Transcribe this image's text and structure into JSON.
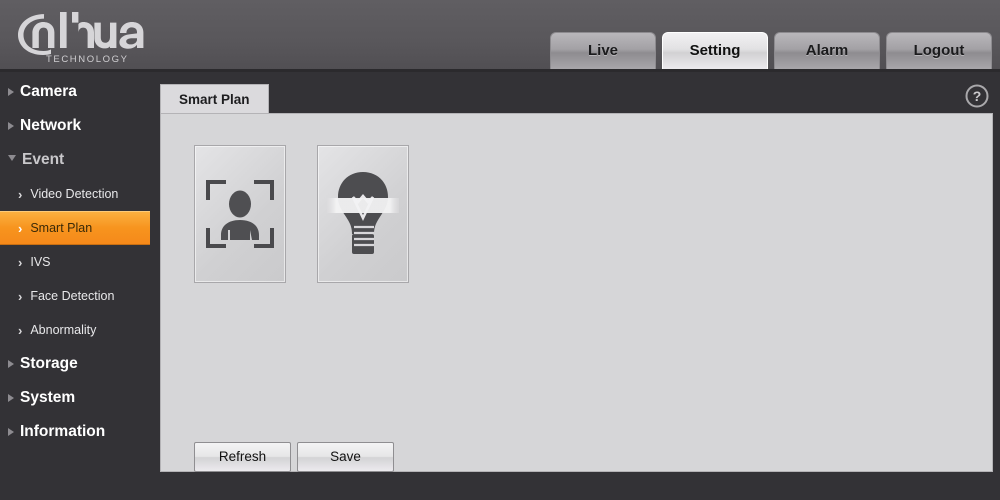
{
  "brand": {
    "name": "alhua",
    "tagline": "TECHNOLOGY",
    "logo_icon": "dahua-logo"
  },
  "topnav": {
    "items": [
      {
        "label": "Live",
        "active": false
      },
      {
        "label": "Setting",
        "active": true
      },
      {
        "label": "Alarm",
        "active": false
      },
      {
        "label": "Logout",
        "active": false
      }
    ]
  },
  "sidebar": {
    "items": [
      {
        "label": "Camera",
        "level": "top",
        "state": "collapsed",
        "icon": "triangle-right-icon"
      },
      {
        "label": "Network",
        "level": "top",
        "state": "collapsed",
        "icon": "triangle-right-icon"
      },
      {
        "label": "Event",
        "level": "top",
        "state": "expanded",
        "icon": "triangle-down-icon"
      },
      {
        "label": "Video Detection",
        "level": "sub",
        "state": "normal",
        "icon": "chevron-right-icon"
      },
      {
        "label": "Smart Plan",
        "level": "sub",
        "state": "selected",
        "icon": "chevron-right-icon"
      },
      {
        "label": "IVS",
        "level": "sub",
        "state": "normal",
        "icon": "chevron-right-icon"
      },
      {
        "label": "Face Detection",
        "level": "sub",
        "state": "normal",
        "icon": "chevron-right-icon"
      },
      {
        "label": "Abnormality",
        "level": "sub",
        "state": "normal",
        "icon": "chevron-right-icon"
      },
      {
        "label": "Storage",
        "level": "top",
        "state": "collapsed",
        "icon": "triangle-right-icon"
      },
      {
        "label": "System",
        "level": "top",
        "state": "collapsed",
        "icon": "triangle-right-icon"
      },
      {
        "label": "Information",
        "level": "top",
        "state": "collapsed",
        "icon": "triangle-right-icon"
      }
    ]
  },
  "main": {
    "tabs": [
      {
        "label": "Smart Plan",
        "active": true
      }
    ],
    "help_icon": "help-question-icon",
    "tiles": [
      {
        "icon": "face-detection-icon",
        "selected": false
      },
      {
        "icon": "lightbulb-smart-icon",
        "selected": false
      }
    ],
    "buttons": [
      {
        "label": "Refresh"
      },
      {
        "label": "Save"
      }
    ]
  },
  "colors": {
    "accent_orange": "#f7941e",
    "header_gray": "#59575b",
    "sidebar_dark": "#333236",
    "panel_gray": "#d6d6d8"
  }
}
